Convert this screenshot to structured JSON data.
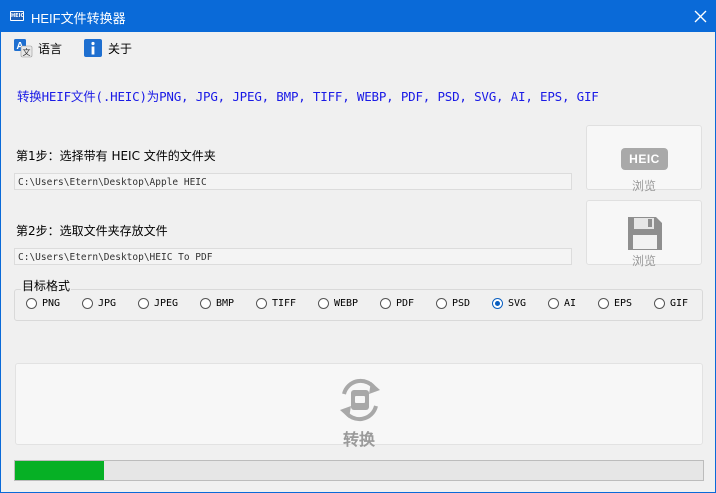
{
  "window": {
    "title": "HEIF文件转换器",
    "icon_text": "HEIC"
  },
  "menu": [
    {
      "label": "语言",
      "icon": "translate-icon"
    },
    {
      "label": "关于",
      "icon": "info-icon"
    }
  ],
  "description": "转换HEIF文件(.HEIC)为PNG, JPG, JPEG, BMP, TIFF, WEBP, PDF, PSD, SVG, AI, EPS, GIF",
  "step1": {
    "label": "第1步：选择带有 HEIC 文件的文件夹",
    "path": "C:\\Users\\Etern\\Desktop\\Apple HEIC",
    "button_label": "浏览",
    "badge": "HEIC"
  },
  "step2": {
    "label": "第2步：选取文件夹存放文件",
    "path": "C:\\Users\\Etern\\Desktop\\HEIC To PDF",
    "button_label": "浏览"
  },
  "target_format": {
    "title": "目标格式",
    "options": [
      "PNG",
      "JPG",
      "JPEG",
      "BMP",
      "TIFF",
      "WEBP",
      "PDF",
      "PSD",
      "SVG",
      "AI",
      "EPS",
      "GIF"
    ],
    "selected": "SVG"
  },
  "convert": {
    "label": "转换"
  },
  "progress": {
    "value": 0.13
  },
  "colors": {
    "accent": "#0a6ad8",
    "progress": "#06b025",
    "description": "#1a1ae6"
  }
}
